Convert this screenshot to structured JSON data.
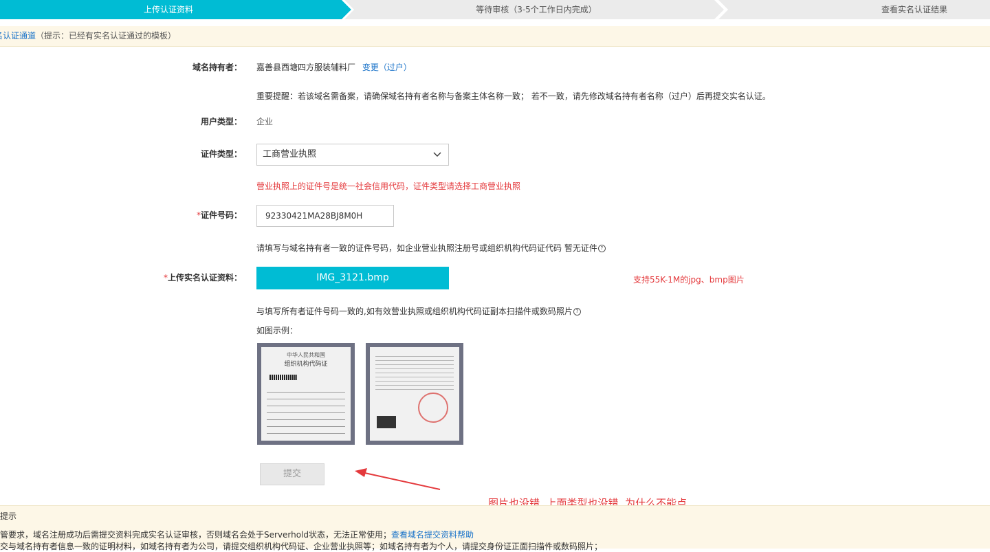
{
  "steps": [
    "上传认证资料",
    "等待审核（3-5个工作日内完成）",
    "查看实名认证结果"
  ],
  "notice": {
    "link": "名认证通道",
    "text": "（提示：已经有实名认证通过的模板）"
  },
  "form": {
    "holder_label": "域名持有者：",
    "holder_value": "嘉善县西塘四方服装辅料厂",
    "holder_change": "变更（过户）",
    "reminder": "重要提醒：若该域名需备案，请确保域名持有者名称与备案主体名称一致； 若不一致，请先修改域名持有者名称（过户）后再提交实名认证。",
    "user_type_label": "用户类型：",
    "user_type_value": "企业",
    "doc_type_label": "证件类型：",
    "doc_type_value": "工商营业执照",
    "doc_type_note": "营业执照上的证件号是统一社会信用代码，证件类型请选择工商营业执照",
    "doc_no_label": "证件号码：",
    "doc_no_value": "92330421MA28BJ8M0H",
    "doc_no_hint": "请填写与域名持有者一致的证件号码，如企业营业执照注册号或组织机构代码证代码 暂无证件",
    "upload_label": "上传实名认证资料：",
    "upload_file": "IMG_3121.bmp",
    "upload_support": "支持55K-1M的jpg、bmp图片",
    "upload_hint": "与填写所有者证件号码一致的,如有效营业执照或组织机构代码证副本扫描件或数码照片",
    "example_label": "如图示例：",
    "sample1_title_line1": "中华人民共和国",
    "sample1_title_line2": "组织机构代码证",
    "submit": "提交"
  },
  "annotation": "图片也没错, 上面类型也没错, 为什么不能点",
  "tips": {
    "title": "提示",
    "line1": "管要求，域名注册成功后需提交资料完成实名认证审核，否则域名会处于Serverhold状态，无法正常使用；",
    "line1_link": "查看域名提交资料帮助",
    "line2": "交与域名持有者信息一致的证明材料，如域名持有者为公司，请提交组织机构代码证、企业营业执照等；如域名持有者为个人，请提交身份证正面扫描件或数码照片；"
  },
  "colors": {
    "active_step": "#00bcd4",
    "inactive_step": "#ebebeb",
    "link": "#1a73c9",
    "warning": "#e4393c",
    "tips_bg": "#fdf7e7"
  },
  "icons": [
    "chevron-down-icon",
    "question-circle-icon",
    "arrow-annotation-icon"
  ]
}
